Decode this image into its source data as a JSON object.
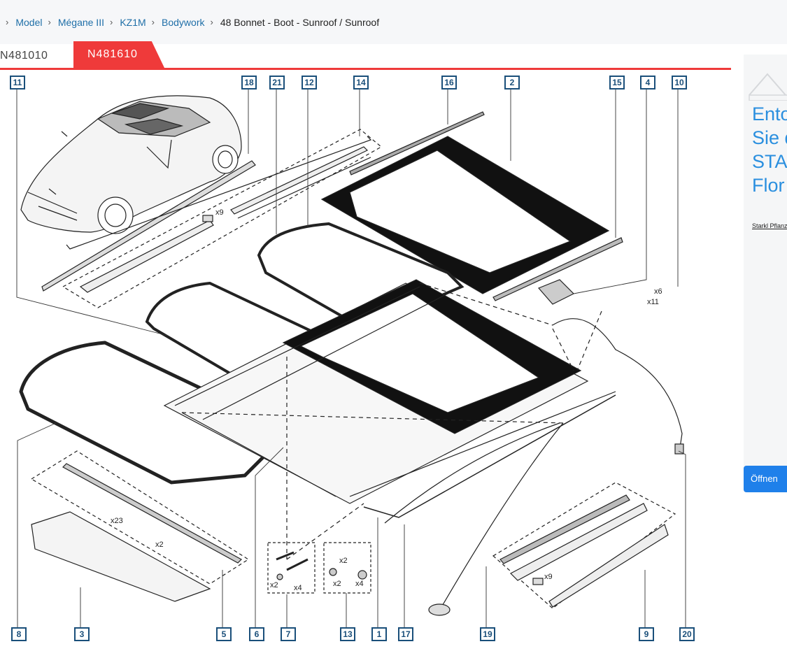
{
  "breadcrumb": {
    "items": [
      "Model",
      "Mégane III",
      "KZ1M",
      "Bodywork"
    ],
    "current": "48 Bonnet - Boot - Sunroof / Sunroof"
  },
  "tabs": [
    {
      "label": "N481010",
      "active": false
    },
    {
      "label": "N481610",
      "active": true
    }
  ],
  "diagram": {
    "callouts": [
      "11",
      "18",
      "21",
      "12",
      "14",
      "16",
      "2",
      "15",
      "4",
      "10",
      "8",
      "3",
      "5",
      "6",
      "7",
      "13",
      "1",
      "17",
      "19",
      "9",
      "20"
    ],
    "quantities": {
      "x9_top": "x9",
      "x6": "x6",
      "x11": "x11",
      "x23": "x23",
      "x2_trim": "x2",
      "x2_a": "x2",
      "x4_a": "x4",
      "x2_b": "x2",
      "x2_c": "x2",
      "x4_b": "x4",
      "x9_bottom": "x9"
    }
  },
  "ad": {
    "headline_lines": [
      "Ento",
      "Sie d",
      "STA",
      "Flor"
    ],
    "subline": "Starkl Pflanzen",
    "button": "Öffnen"
  },
  "colors": {
    "accent": "#ef3a3a",
    "link": "#1f6fa8",
    "callout": "#1a4f7a",
    "ad_blue": "#2a8fdf",
    "button": "#1f80ea"
  }
}
